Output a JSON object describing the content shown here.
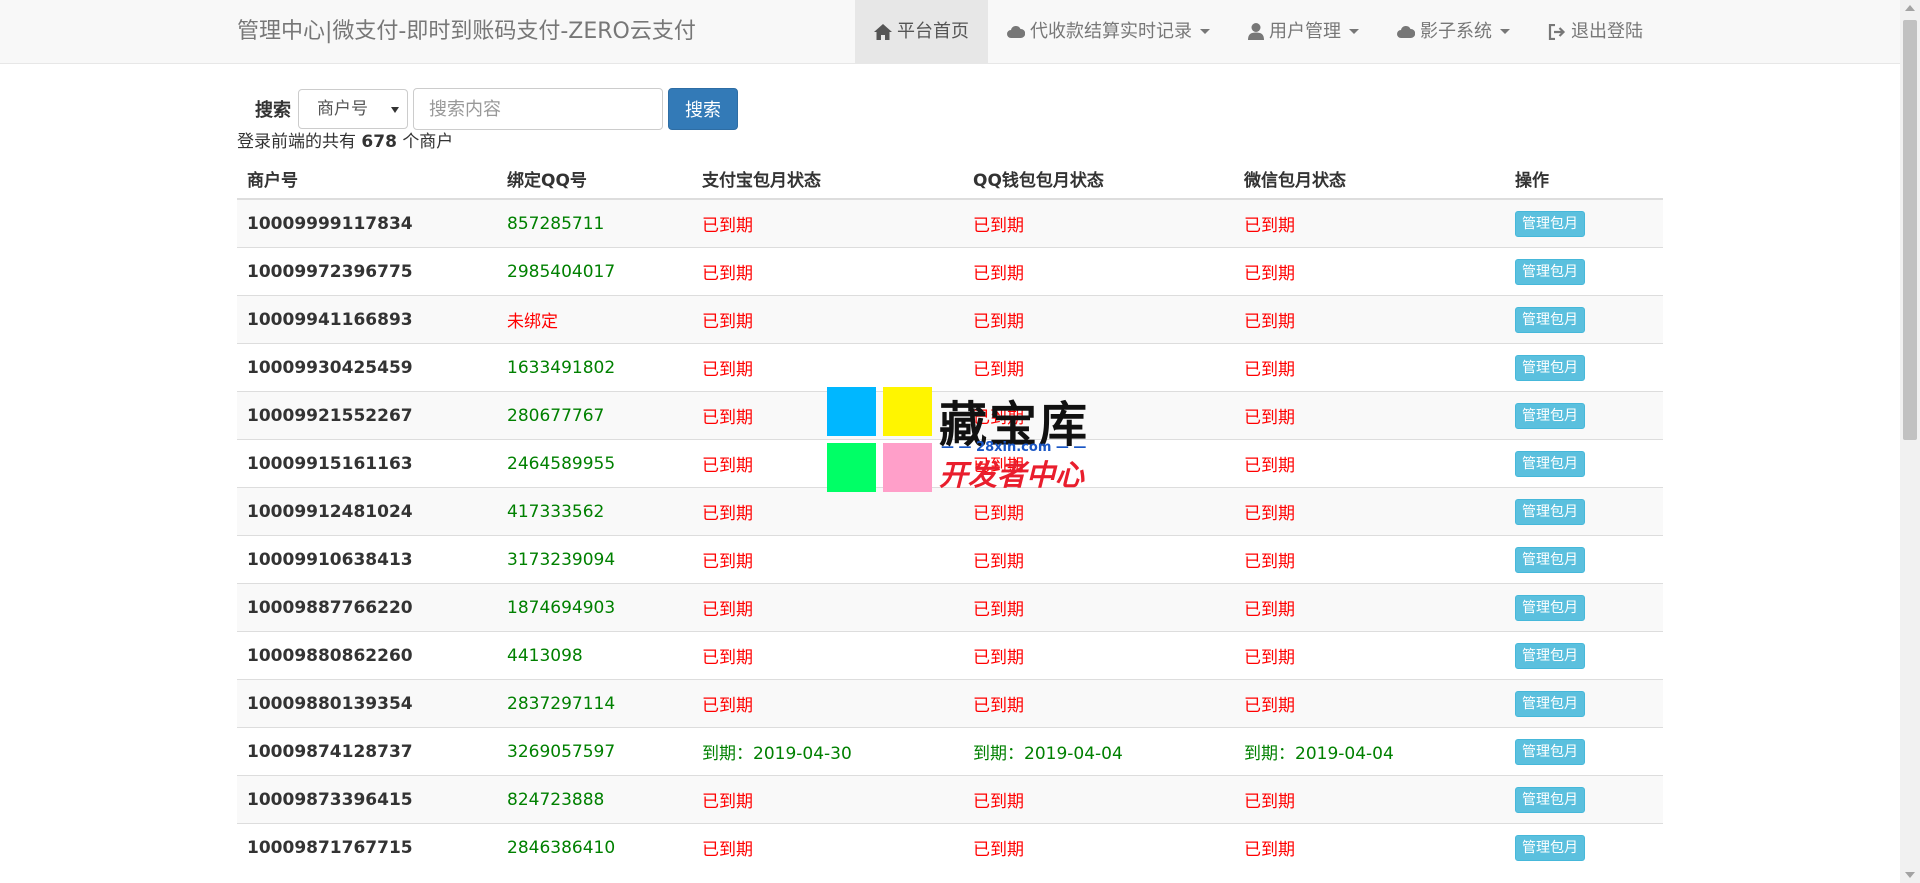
{
  "navbar": {
    "brand": "管理中心|微支付-即时到账码支付-ZERO云支付",
    "items": [
      {
        "label": "平台首页",
        "icon": "home-icon",
        "active": true,
        "dropdown": false
      },
      {
        "label": "代收款结算实时记录",
        "icon": "cloud-icon",
        "active": false,
        "dropdown": true
      },
      {
        "label": "用户管理",
        "icon": "user-icon",
        "active": false,
        "dropdown": true
      },
      {
        "label": "影子系统",
        "icon": "cloud-icon",
        "active": false,
        "dropdown": true
      },
      {
        "label": "退出登陆",
        "icon": "logout-icon",
        "active": false,
        "dropdown": false
      }
    ]
  },
  "search": {
    "label": "搜索",
    "select_value": "商户号",
    "placeholder": "搜索内容",
    "button_label": "搜索"
  },
  "summary": {
    "prefix": "登录前端的共有",
    "count": "678",
    "suffix": "个商户"
  },
  "table": {
    "headers": [
      "商户号",
      "绑定QQ号",
      "支付宝包月状态",
      "QQ钱包包月状态",
      "微信包月状态",
      "操作"
    ],
    "button_label": "管理包月",
    "rows": [
      {
        "merchant": "10009999117834",
        "qq": "857285711",
        "alipay": "已到期",
        "qqwallet": "已到期",
        "wechat": "已到期"
      },
      {
        "merchant": "10009972396775",
        "qq": "2985404017",
        "alipay": "已到期",
        "qqwallet": "已到期",
        "wechat": "已到期"
      },
      {
        "merchant": "10009941166893",
        "qq": "未绑定",
        "alipay": "已到期",
        "qqwallet": "已到期",
        "wechat": "已到期"
      },
      {
        "merchant": "10009930425459",
        "qq": "1633491802",
        "alipay": "已到期",
        "qqwallet": "已到期",
        "wechat": "已到期"
      },
      {
        "merchant": "10009921552267",
        "qq": "280677767",
        "alipay": "已到期",
        "qqwallet": "已到期",
        "wechat": "已到期"
      },
      {
        "merchant": "10009915161163",
        "qq": "2464589955",
        "alipay": "已到期",
        "qqwallet": "已到期",
        "wechat": "已到期"
      },
      {
        "merchant": "10009912481024",
        "qq": "417333562",
        "alipay": "已到期",
        "qqwallet": "已到期",
        "wechat": "已到期"
      },
      {
        "merchant": "10009910638413",
        "qq": "3173239094",
        "alipay": "已到期",
        "qqwallet": "已到期",
        "wechat": "已到期"
      },
      {
        "merchant": "10009887766220",
        "qq": "1874694903",
        "alipay": "已到期",
        "qqwallet": "已到期",
        "wechat": "已到期"
      },
      {
        "merchant": "10009880862260",
        "qq": "4413098",
        "alipay": "已到期",
        "qqwallet": "已到期",
        "wechat": "已到期"
      },
      {
        "merchant": "10009880139354",
        "qq": "2837297114",
        "alipay": "已到期",
        "qqwallet": "已到期",
        "wechat": "已到期"
      },
      {
        "merchant": "10009874128737",
        "qq": "3269057597",
        "alipay": "到期：2019-04-30",
        "qqwallet": "到期：2019-04-04",
        "wechat": "到期：2019-04-04"
      },
      {
        "merchant": "10009873396415",
        "qq": "824723888",
        "alipay": "已到期",
        "qqwallet": "已到期",
        "wechat": "已到期"
      },
      {
        "merchant": "10009871767715",
        "qq": "2846386410",
        "alipay": "已到期",
        "qqwallet": "已到期",
        "wechat": "已到期"
      }
    ]
  },
  "watermark": {
    "title": "藏宝库",
    "url": "— — 28xin.com — —",
    "subtitle": "开发者中心",
    "colors": [
      "#00b7ff",
      "#fff500",
      "#00ff66",
      "#ff9fc9"
    ]
  },
  "colors": {
    "expired": "#ff0000",
    "active": "#008000",
    "primary": "#337ab7",
    "info": "#5bc0de"
  }
}
